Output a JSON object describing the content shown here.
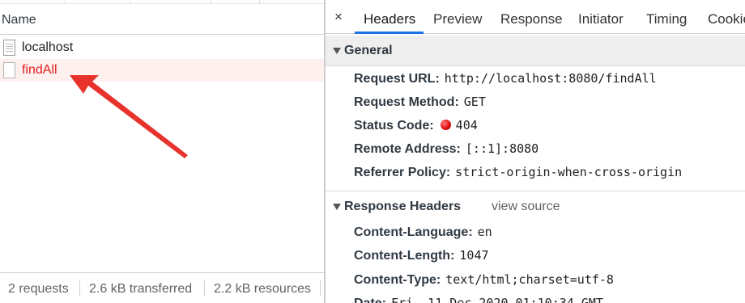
{
  "network": {
    "column_header": "Name",
    "requests": [
      {
        "name": "localhost",
        "status": "ok"
      },
      {
        "name": "findAll",
        "status": "error"
      }
    ],
    "summary": {
      "requests": "2 requests",
      "transferred": "2.6 kB transferred",
      "resources": "2.2 kB resources"
    }
  },
  "details": {
    "close_glyph": "×",
    "tabs": [
      "Headers",
      "Preview",
      "Response",
      "Initiator",
      "Timing",
      "Cookies"
    ],
    "active_tab": "Headers",
    "general": {
      "title": "General",
      "rows": [
        {
          "key": "Request URL:",
          "value": "http://localhost:8080/findAll"
        },
        {
          "key": "Request Method:",
          "value": "GET"
        },
        {
          "key": "Status Code:",
          "value": "404",
          "indicator_color": "#e01010"
        },
        {
          "key": "Remote Address:",
          "value": "[::1]:8080"
        },
        {
          "key": "Referrer Policy:",
          "value": "strict-origin-when-cross-origin"
        }
      ]
    },
    "response_headers": {
      "title": "Response Headers",
      "view_source": "view source",
      "rows": [
        {
          "key": "Content-Language:",
          "value": "en"
        },
        {
          "key": "Content-Length:",
          "value": "1047"
        },
        {
          "key": "Content-Type:",
          "value": "text/html;charset=utf-8"
        },
        {
          "key": "Date:",
          "value": "Fri, 11 Dec 2020 01:10:34 GMT"
        }
      ]
    }
  },
  "colors": {
    "error_text": "#e31c1c",
    "error_row_bg": "#fff0f0",
    "active_tab_underline": "#1a73e8",
    "annotation_arrow": "#e8322c"
  },
  "icons": [
    "document-icon",
    "close-icon",
    "disclosure-triangle-icon",
    "status-error-dot-icon",
    "annotation-arrow-icon"
  ]
}
